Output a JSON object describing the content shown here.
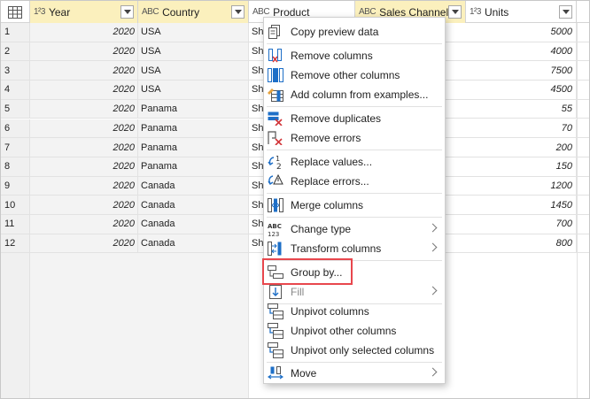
{
  "columns": [
    {
      "type_icon": "1²3",
      "label": "Year"
    },
    {
      "type_icon": "ABC",
      "label": "Country"
    },
    {
      "type_icon": "ABC",
      "label": "Product"
    },
    {
      "type_icon": "ABC",
      "label": "Sales Channel"
    },
    {
      "type_icon": "1²3",
      "label": "Units"
    }
  ],
  "rows": [
    {
      "num": "1",
      "year": "2020",
      "country": "USA",
      "product": "Shi",
      "units": "5000"
    },
    {
      "num": "2",
      "year": "2020",
      "country": "USA",
      "product": "Shi",
      "units": "4000"
    },
    {
      "num": "3",
      "year": "2020",
      "country": "USA",
      "product": "Shi",
      "units": "7500"
    },
    {
      "num": "4",
      "year": "2020",
      "country": "USA",
      "product": "Shi",
      "units": "4500"
    },
    {
      "num": "5",
      "year": "2020",
      "country": "Panama",
      "product": "Shi",
      "units": "55"
    },
    {
      "num": "6",
      "year": "2020",
      "country": "Panama",
      "product": "Shi",
      "units": "70"
    },
    {
      "num": "7",
      "year": "2020",
      "country": "Panama",
      "product": "Shi",
      "units": "200"
    },
    {
      "num": "8",
      "year": "2020",
      "country": "Panama",
      "product": "Shi",
      "units": "150"
    },
    {
      "num": "9",
      "year": "2020",
      "country": "Canada",
      "product": "Shi",
      "units": "1200"
    },
    {
      "num": "10",
      "year": "2020",
      "country": "Canada",
      "product": "Shi",
      "units": "1450"
    },
    {
      "num": "11",
      "year": "2020",
      "country": "Canada",
      "product": "Shi",
      "units": "700"
    },
    {
      "num": "12",
      "year": "2020",
      "country": "Canada",
      "product": "Shi",
      "units": "800"
    }
  ],
  "menu": {
    "copy_preview": "Copy preview data",
    "remove_columns": "Remove columns",
    "remove_other_columns": "Remove other columns",
    "add_column_examples": "Add column from examples...",
    "remove_duplicates": "Remove duplicates",
    "remove_errors": "Remove errors",
    "replace_values": "Replace values...",
    "replace_errors": "Replace errors...",
    "merge_columns": "Merge columns",
    "change_type": "Change type",
    "transform_columns": "Transform columns",
    "group_by": "Group by...",
    "fill": "Fill",
    "unpivot_columns": "Unpivot columns",
    "unpivot_other_columns": "Unpivot other columns",
    "unpivot_selected_columns": "Unpivot only selected columns",
    "move": "Move"
  },
  "colors": {
    "selected_header": "#fbf0bd",
    "highlight_border": "#e8474d",
    "icon_blue": "#1e6fc7",
    "icon_red": "#d13438"
  }
}
